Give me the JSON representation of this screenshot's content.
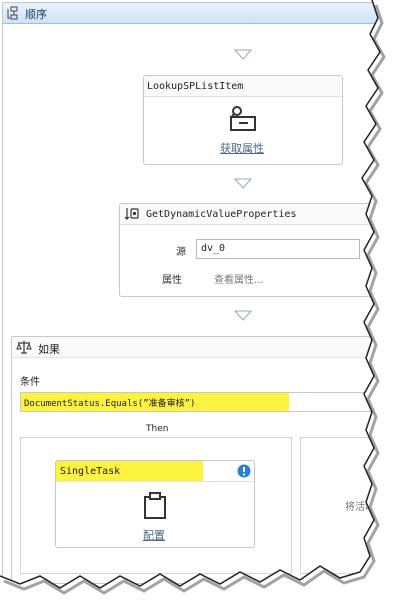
{
  "sequence": {
    "title": "顺序"
  },
  "lookup": {
    "title": "LookupSPListItem",
    "action_label": "获取属性"
  },
  "getdyn": {
    "title": "GetDynamicValueProperties",
    "source_label": "源",
    "source_value": "dv_0",
    "props_label": "属性",
    "props_value": "查看属性..."
  },
  "ifblock": {
    "title": "如果",
    "condition_label": "条件",
    "condition_value": "DocumentStatus.Equals(”准备审核”)",
    "then_label": "Then",
    "else_label_partial": "E",
    "else_placeholder_partial": "将活动"
  },
  "singletask": {
    "title": "SingleTask",
    "action_label": "配置"
  }
}
